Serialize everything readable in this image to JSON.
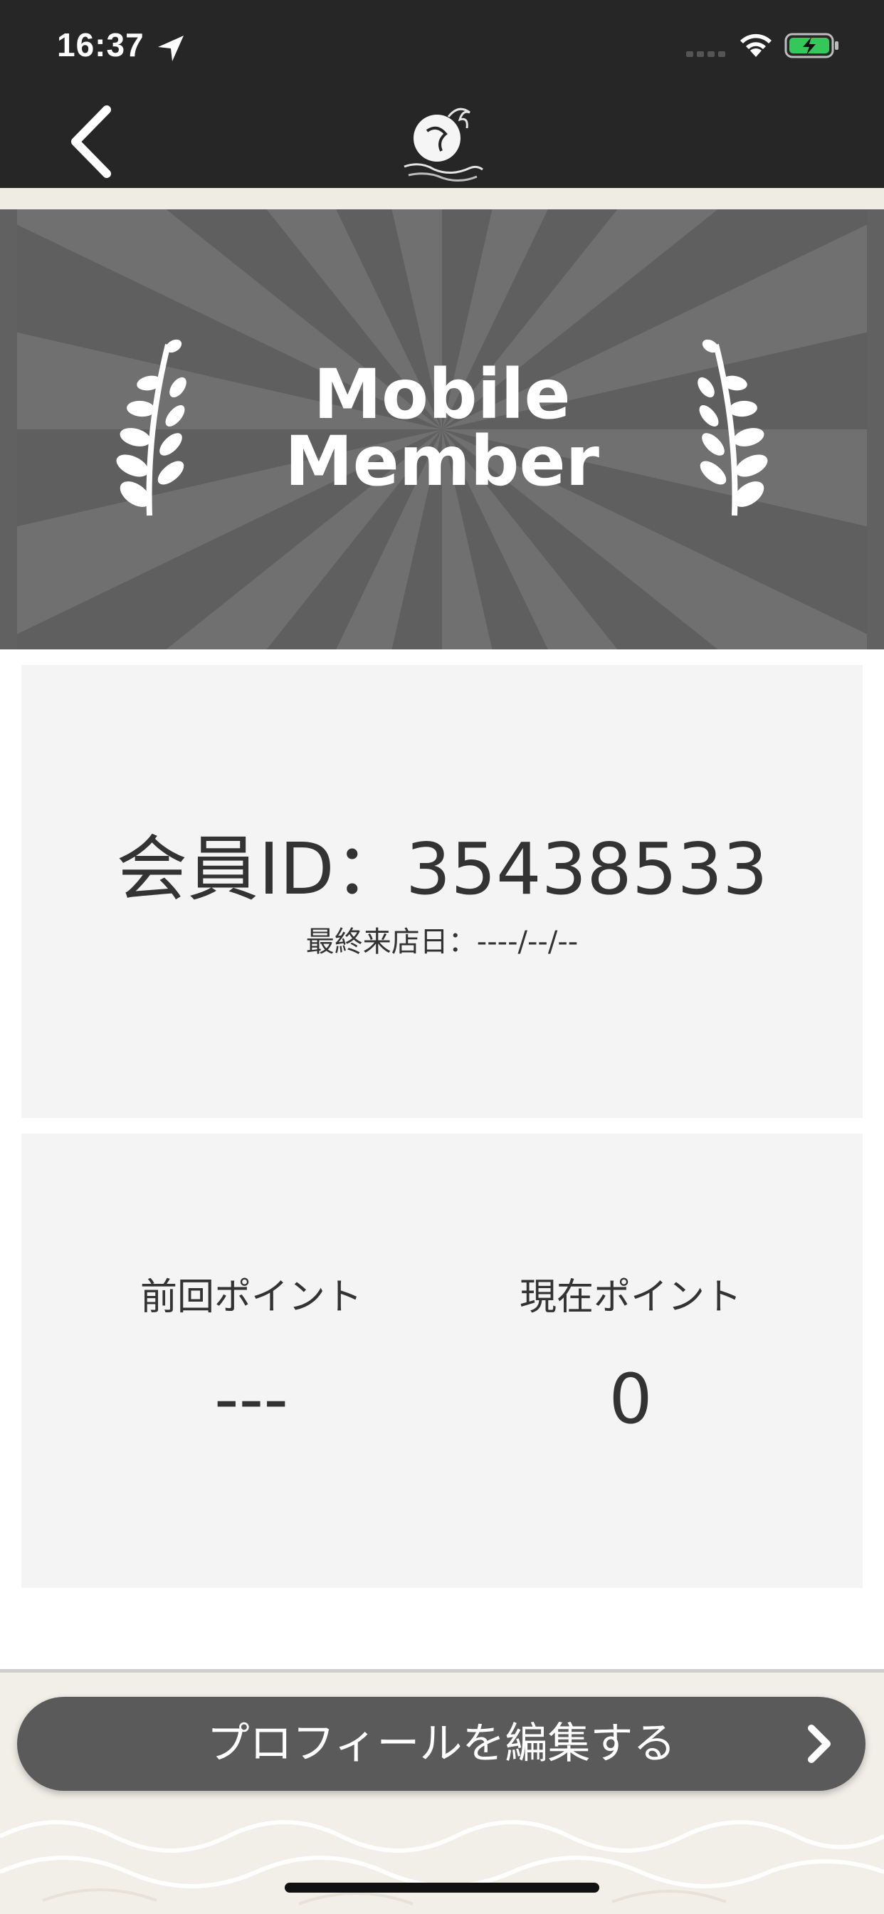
{
  "status_bar": {
    "time": "16:37",
    "icons": [
      "location-arrow-icon",
      "signal-icon",
      "wifi-icon",
      "battery-charging-icon"
    ]
  },
  "nav": {
    "back_icon": "chevron-left-icon",
    "logo": "brand-logo"
  },
  "hero": {
    "title_line1": "Mobile",
    "title_line2": "Member"
  },
  "member": {
    "id_text": "会員ID：35438533",
    "last_visit_text": "最終来店日：----/--/--"
  },
  "points": {
    "previous_label": "前回ポイント",
    "previous_value": "---",
    "current_label": "現在ポイント",
    "current_value": "0"
  },
  "actions": {
    "edit_profile_label": "プロフィールを編集する"
  },
  "colors": {
    "bar_bg": "#262626",
    "hero_bg": "#616161",
    "card_bg": "#f4f4f4",
    "button_bg": "#5a5a5a",
    "battery_green": "#34c759"
  }
}
